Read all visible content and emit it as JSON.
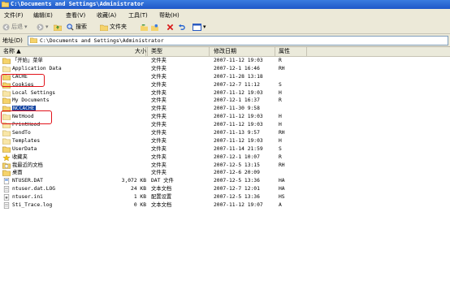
{
  "window": {
    "title": "C:\\Documents and Settings\\Administrator"
  },
  "menu": [
    "文件(F)",
    "编辑(E)",
    "查看(V)",
    "收藏(A)",
    "工具(T)",
    "帮助(H)"
  ],
  "toolbar": {
    "back": "后退",
    "search": "搜索",
    "folders": "文件夹"
  },
  "address": {
    "label": "地址(D)",
    "value": "C:\\Documents and Settings\\Administrator"
  },
  "columns": {
    "name": "名称 ▲",
    "size": "大小",
    "type": "类型",
    "date": "修改日期",
    "attr": "属性"
  },
  "files": [
    {
      "name": "「开始」菜单",
      "size": "",
      "type": "文件夹",
      "date": "2007-11-12 19:03",
      "attr": "R",
      "icon": "folder-icon"
    },
    {
      "name": "Application Data",
      "size": "",
      "type": "文件夹",
      "date": "2007-12-1 16:46",
      "attr": "RH",
      "icon": "folder-hidden-icon"
    },
    {
      "name": "CACHE",
      "size": "",
      "type": "文件夹",
      "date": "2007-11-28 13:18",
      "attr": "",
      "icon": "folder-icon"
    },
    {
      "name": "Cookies",
      "size": "",
      "type": "文件夹",
      "date": "2007-12-7 11:12",
      "attr": "S",
      "icon": "folder-icon"
    },
    {
      "name": "Local Settings",
      "size": "",
      "type": "文件夹",
      "date": "2007-11-12 19:03",
      "attr": "H",
      "icon": "folder-hidden-icon"
    },
    {
      "name": "My Documents",
      "size": "",
      "type": "文件夹",
      "date": "2007-12-1 16:37",
      "attr": "R",
      "icon": "folder-icon"
    },
    {
      "name": "NCCACHE",
      "size": "",
      "type": "文件夹",
      "date": "2007-11-30 9:58",
      "attr": "",
      "icon": "folder-icon"
    },
    {
      "name": "NetHood",
      "size": "",
      "type": "文件夹",
      "date": "2007-11-12 19:03",
      "attr": "H",
      "icon": "folder-hidden-icon"
    },
    {
      "name": "PrintHood",
      "size": "",
      "type": "文件夹",
      "date": "2007-11-12 19:03",
      "attr": "H",
      "icon": "folder-hidden-icon"
    },
    {
      "name": "SendTo",
      "size": "",
      "type": "文件夹",
      "date": "2007-11-13 9:57",
      "attr": "RH",
      "icon": "folder-hidden-icon"
    },
    {
      "name": "Templates",
      "size": "",
      "type": "文件夹",
      "date": "2007-11-12 19:03",
      "attr": "H",
      "icon": "folder-hidden-icon"
    },
    {
      "name": "UserData",
      "size": "",
      "type": "文件夹",
      "date": "2007-11-14 21:59",
      "attr": "S",
      "icon": "folder-icon"
    },
    {
      "name": "收藏夹",
      "size": "",
      "type": "文件夹",
      "date": "2007-12-1 10:07",
      "attr": "R",
      "icon": "favorites-star-icon"
    },
    {
      "name": "我最近的文档",
      "size": "",
      "type": "文件夹",
      "date": "2007-12-5 13:15",
      "attr": "RH",
      "icon": "recent-docs-icon"
    },
    {
      "name": "桌面",
      "size": "",
      "type": "文件夹",
      "date": "2007-12-6 20:09",
      "attr": "",
      "icon": "folder-icon"
    },
    {
      "name": "NTUSER.DAT",
      "size": "3,072 KB",
      "type": "DAT 文件",
      "date": "2007-12-5 13:36",
      "attr": "HA",
      "icon": "file-icon"
    },
    {
      "name": "ntuser.dat.LOG",
      "size": "24 KB",
      "type": "文本文档",
      "date": "2007-12-7 12:01",
      "attr": "HA",
      "icon": "text-file-icon"
    },
    {
      "name": "ntuser.ini",
      "size": "1 KB",
      "type": "配置设置",
      "date": "2007-12-5 13:36",
      "attr": "HS",
      "icon": "ini-file-icon"
    },
    {
      "name": "Sti_Trace.log",
      "size": "0 KB",
      "type": "文本文档",
      "date": "2007-11-12 19:07",
      "attr": "A",
      "icon": "text-file-icon"
    }
  ],
  "colors": {
    "titlebar": "#2a6ad8",
    "highlight_box": "#e2121a",
    "selection": "#0b3c9c",
    "folder": "#f5d36b"
  }
}
